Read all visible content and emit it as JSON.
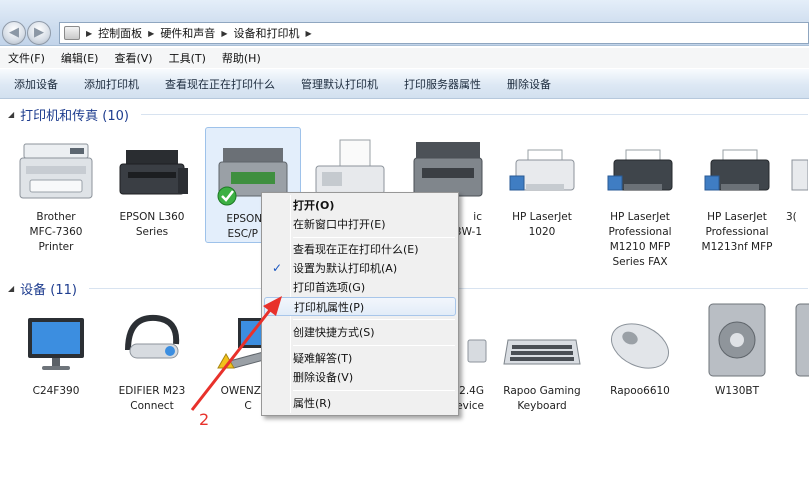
{
  "addressbar": {
    "breadcrumb": [
      "控制面板",
      "硬件和声音",
      "设备和打印机"
    ]
  },
  "menubar": [
    "文件(F)",
    "编辑(E)",
    "查看(V)",
    "工具(T)",
    "帮助(H)"
  ],
  "commandbar": [
    "添加设备",
    "添加打印机",
    "查看现在正在打印什么",
    "管理默认打印机",
    "打印服务器属性",
    "删除设备"
  ],
  "printers_group": {
    "title": "打印机和传真 (10)",
    "items": [
      {
        "label": "Brother\nMFC-7360\nPrinter",
        "icon": "printer-mfc-icon"
      },
      {
        "label": "EPSON L360\nSeries",
        "icon": "printer-inkjet-icon"
      },
      {
        "label": "EPSON LQ\nESC/P 2 V",
        "icon": "printer-default-icon",
        "default": true
      },
      {
        "label": "",
        "icon": "fax-icon"
      },
      {
        "label": "ic\n3W-1",
        "icon": "printer-mfc-icon"
      },
      {
        "label": "HP LaserJet\n1020",
        "icon": "printer-laser-icon"
      },
      {
        "label": "HP LaserJet\nProfessional\nM1210 MFP\nSeries FAX",
        "icon": "printer-laser-icon"
      },
      {
        "label": "HP LaserJet\nProfessional\nM1213nf MFP",
        "icon": "printer-laser-icon"
      },
      {
        "label": "3(",
        "icon": "printer-partial-icon"
      }
    ]
  },
  "devices_group": {
    "title": "设备 (11)",
    "items": [
      {
        "label": "C24F390",
        "icon": "monitor-icon"
      },
      {
        "label": "EDIFIER M23\nConnect",
        "icon": "headset-icon"
      },
      {
        "label": "OWENZHE\nC",
        "icon": "laptop-icon"
      },
      {
        "label": "2.4G\nevice",
        "icon": "usb-device-icon"
      },
      {
        "label": "Rapoo Gaming\nKeyboard",
        "icon": "keyboard-icon"
      },
      {
        "label": "Rapoo6610",
        "icon": "mouse-icon"
      },
      {
        "label": "W130BT",
        "icon": "speaker-icon"
      }
    ]
  },
  "context_menu": {
    "items": [
      {
        "label": "打开(O)",
        "bold": true
      },
      {
        "label": "在新窗口中打开(E)"
      },
      {
        "separator": true
      },
      {
        "label": "查看现在正在打印什么(E)"
      },
      {
        "label": "设置为默认打印机(A)",
        "checked": true
      },
      {
        "label": "打印首选项(G)"
      },
      {
        "label": "打印机属性(P)",
        "highlighted": true
      },
      {
        "separator": true
      },
      {
        "label": "创建快捷方式(S)"
      },
      {
        "separator": true
      },
      {
        "label": "疑难解答(T)"
      },
      {
        "label": "删除设备(V)"
      },
      {
        "separator": true
      },
      {
        "label": "属性(R)"
      }
    ]
  },
  "annotation": {
    "step_number": "2",
    "color": "#e8312b"
  },
  "colors": {
    "group_title": "#1e3d8f",
    "selection": "#e3eefb",
    "menu_bg": "#f0f0f0"
  }
}
